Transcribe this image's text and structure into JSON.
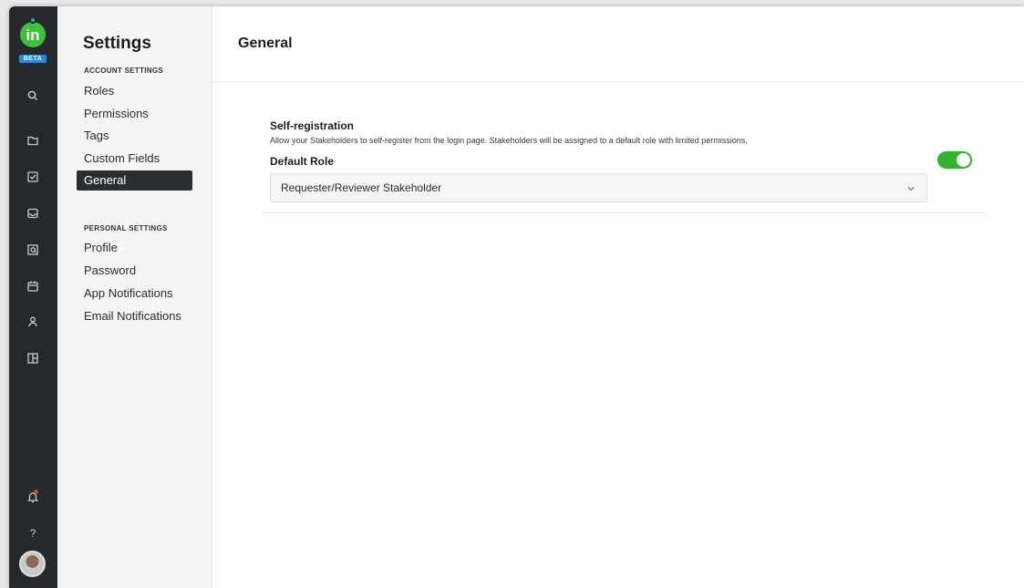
{
  "brand": {
    "logo_text": "in",
    "badge": "BETA",
    "accent": "#3fbf3f",
    "badge_color": "#2f86d6"
  },
  "rail": {
    "icons": [
      "search-icon",
      "folder-icon",
      "checkbox-icon",
      "inbox-icon",
      "review-icon",
      "calendar-icon",
      "person-icon",
      "layout-icon"
    ],
    "bottom": {
      "notification": "bell-icon",
      "help_label": "?",
      "avatar": "user-avatar"
    }
  },
  "settings": {
    "title": "Settings",
    "account_label": "ACCOUNT SETTINGS",
    "account_items": [
      "Roles",
      "Permissions",
      "Tags",
      "Custom Fields",
      "General"
    ],
    "active_item": "General",
    "personal_label": "PERSONAL SETTINGS",
    "personal_items": [
      "Profile",
      "Password",
      "App Notifications",
      "Email Notifications"
    ]
  },
  "main": {
    "title": "General",
    "self_registration": {
      "title": "Self-registration",
      "description": "Allow your Stakeholders to self-register from the login page. Stakeholders will be assigned to a default role with limited permissions.",
      "enabled": true,
      "toggle_color": "#34b233"
    },
    "default_role": {
      "label": "Default Role",
      "value": "Requester/Reviewer Stakeholder"
    }
  }
}
